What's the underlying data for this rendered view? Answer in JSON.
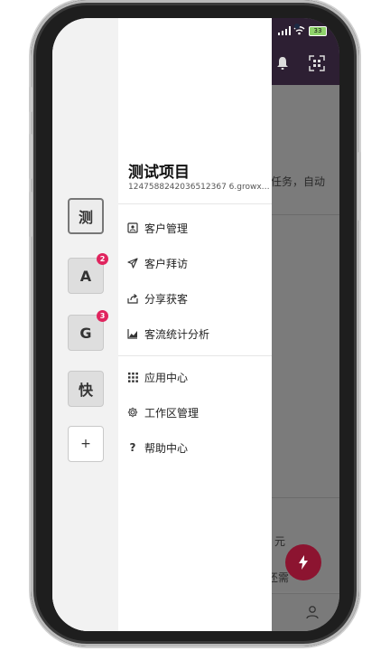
{
  "status_bar": {
    "time": "",
    "battery": "33"
  },
  "drawer": {
    "workspaces": [
      {
        "label": "测",
        "badge": "",
        "active": true
      },
      {
        "label": "A",
        "badge": "2",
        "active": false
      },
      {
        "label": "G",
        "badge": "3",
        "active": false
      },
      {
        "label": "快",
        "badge": "",
        "active": false
      },
      {
        "label": "+",
        "badge": "",
        "active": false
      }
    ],
    "project": {
      "title": "测试项目",
      "id": "1247588242036512367 6.growxx.co..."
    },
    "menu_group_1": [
      {
        "label": "客户管理",
        "icon": "contact-card-icon"
      },
      {
        "label": "客户拜访",
        "icon": "send-icon"
      },
      {
        "label": "分享获客",
        "icon": "share-icon"
      },
      {
        "label": "客流统计分析",
        "icon": "chart-icon"
      }
    ],
    "menu_group_2": [
      {
        "label": "应用中心",
        "icon": "grid-icon"
      },
      {
        "label": "工作区管理",
        "icon": "gear-icon"
      },
      {
        "label": "帮助中心",
        "icon": "help-icon"
      }
    ]
  },
  "background": {
    "text_task": "任务，自动",
    "text_yuan": "元",
    "text_other": "还需"
  }
}
